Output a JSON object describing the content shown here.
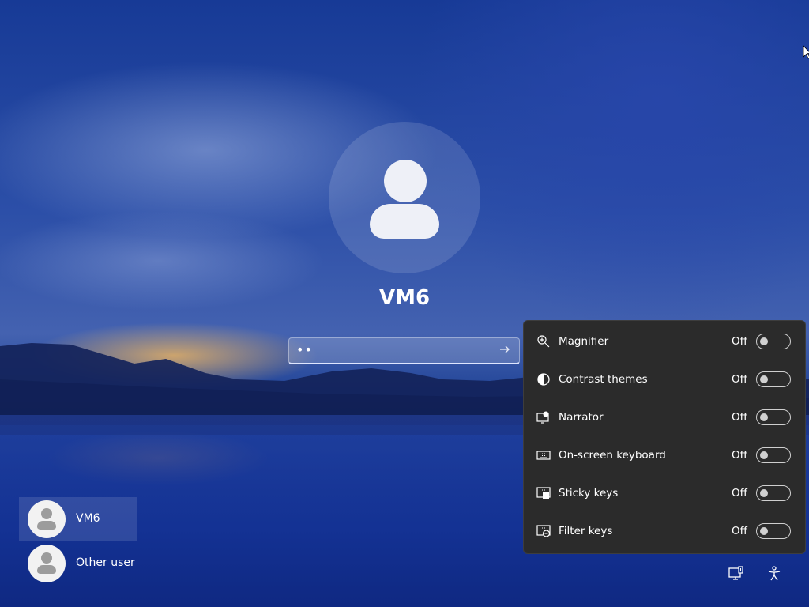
{
  "user": {
    "name": "VM6",
    "password_mask": "••"
  },
  "users_list": [
    {
      "label": "VM6",
      "selected": true
    },
    {
      "label": "Other user",
      "selected": false
    }
  ],
  "accessibility": {
    "items": [
      {
        "label": "Magnifier",
        "state": "Off",
        "icon": "magnifier-icon"
      },
      {
        "label": "Contrast themes",
        "state": "Off",
        "icon": "contrast-icon"
      },
      {
        "label": "Narrator",
        "state": "Off",
        "icon": "narrator-icon"
      },
      {
        "label": "On-screen keyboard",
        "state": "Off",
        "icon": "keyboard-icon"
      },
      {
        "label": "Sticky keys",
        "state": "Off",
        "icon": "sticky-keys-icon"
      },
      {
        "label": "Filter keys",
        "state": "Off",
        "icon": "filter-keys-icon"
      }
    ]
  },
  "tray": {
    "network_icon": "network-icon",
    "accessibility_icon": "accessibility-icon"
  },
  "colors": {
    "flyout_bg": "#2b2b2b",
    "sky": "#173a96"
  }
}
